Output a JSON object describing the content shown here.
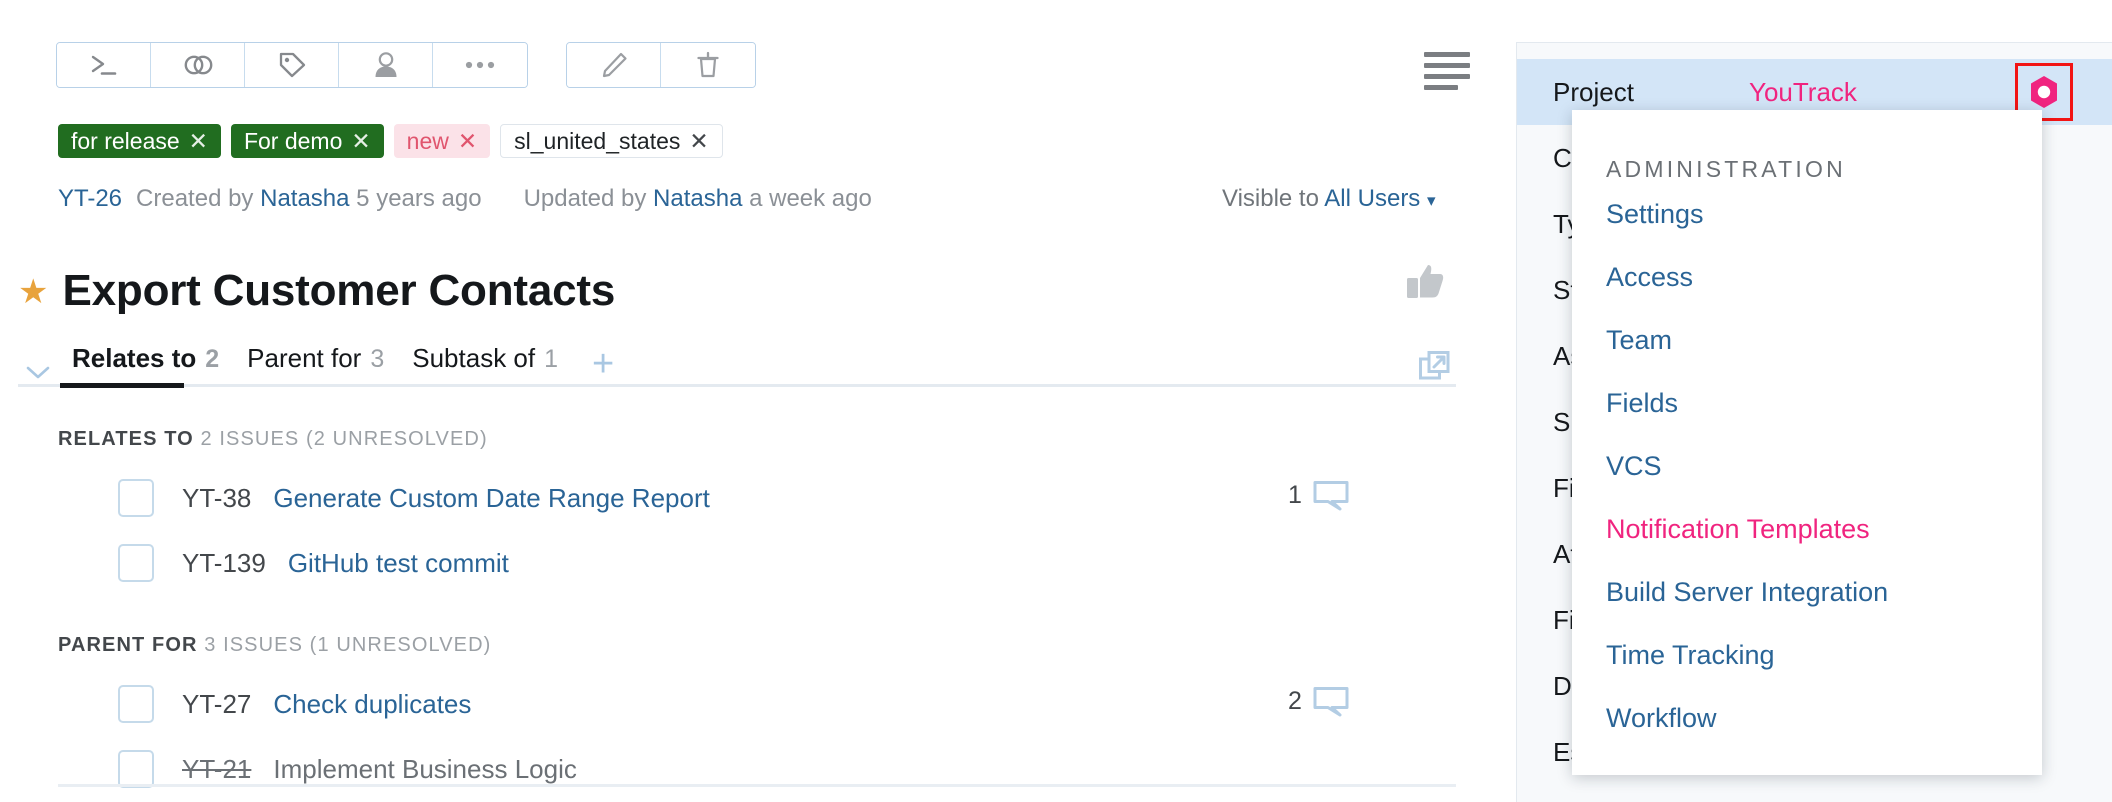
{
  "toolbar": {
    "left_group": [
      {
        "name": "command-dialog-icon",
        "label": "Apply command"
      },
      {
        "name": "link-icon",
        "label": "Link issue"
      },
      {
        "name": "tag-icon",
        "label": "Add tag"
      },
      {
        "name": "user-icon",
        "label": "Assign"
      },
      {
        "name": "more-icon",
        "label": "More"
      }
    ],
    "right_group": [
      {
        "name": "edit-pencil-icon",
        "label": "Edit"
      },
      {
        "name": "delete-trash-icon",
        "label": "Delete"
      }
    ],
    "list_view_icon": "list-view-icon"
  },
  "tags": [
    {
      "label": "for release",
      "style": "green",
      "close": "✕"
    },
    {
      "label": "For demo",
      "style": "green",
      "close": "✕"
    },
    {
      "label": "new",
      "style": "pink",
      "close": "✕"
    },
    {
      "label": "sl_united_states",
      "style": "plain",
      "close": "✕"
    }
  ],
  "meta": {
    "issue_id": "YT-26",
    "created_prefix": "Created by",
    "created_by": "Natasha",
    "created_when": "5 years ago",
    "updated_prefix": "Updated by",
    "updated_by": "Natasha",
    "updated_when": "a week ago",
    "visible_prefix": "Visible to",
    "visible_value": "All Users",
    "visible_caret": "▾"
  },
  "title": {
    "star": "★",
    "text": "Export Customer Contacts",
    "vote_icon": "thumbs-up-icon"
  },
  "tabs": {
    "items": [
      {
        "label": "Relates to",
        "count": "2",
        "active": true
      },
      {
        "label": "Parent for",
        "count": "3",
        "active": false
      },
      {
        "label": "Subtask of",
        "count": "1",
        "active": false
      }
    ],
    "add_label": "+",
    "external_link_icon": "external-link-icon",
    "collapse_icon": "chevron-down-icon"
  },
  "sections": [
    {
      "title_strong": "RELATES TO",
      "title_rest": "2 ISSUES (2 UNRESOLVED)",
      "rows": [
        {
          "id": "YT-38",
          "summary": "Generate Custom Date Range Report",
          "resolved": false,
          "comments": "1"
        },
        {
          "id": "YT-139",
          "summary": "GitHub test commit",
          "resolved": false,
          "comments": ""
        }
      ]
    },
    {
      "title_strong": "PARENT FOR",
      "title_rest": "3 ISSUES (1 UNRESOLVED)",
      "rows": [
        {
          "id": "YT-27",
          "summary": "Check duplicates",
          "resolved": false,
          "comments": "2"
        },
        {
          "id": "YT-21",
          "summary": "Implement Business Logic",
          "resolved": true,
          "comments": ""
        }
      ]
    }
  ],
  "sidebar": {
    "rows": [
      {
        "label": "Project",
        "value": "YouTrack",
        "highlight": true,
        "gear": true
      },
      {
        "label": "Com",
        "value": "",
        "highlight": false,
        "gear": false
      },
      {
        "label": "Typ",
        "value": "",
        "highlight": false,
        "gear": false
      },
      {
        "label": "Sta",
        "value": "",
        "highlight": false,
        "gear": false
      },
      {
        "label": "Ass",
        "value": "",
        "highlight": false,
        "gear": false
      },
      {
        "label": "Sub",
        "value": "",
        "highlight": false,
        "gear": false
      },
      {
        "label": "Fix",
        "value": "",
        "highlight": false,
        "gear": false
      },
      {
        "label": "Affe",
        "value": "",
        "highlight": false,
        "gear": false
      },
      {
        "label": "Fixe",
        "value": "",
        "highlight": false,
        "gear": false
      },
      {
        "label": "Due",
        "value": "",
        "highlight": false,
        "gear": false
      },
      {
        "label": "Est",
        "value": "",
        "highlight": false,
        "gear": false
      }
    ]
  },
  "dropdown": {
    "heading": "ADMINISTRATION",
    "items": [
      {
        "label": "Settings",
        "hovered": false
      },
      {
        "label": "Access",
        "hovered": false
      },
      {
        "label": "Team",
        "hovered": false
      },
      {
        "label": "Fields",
        "hovered": false
      },
      {
        "label": "VCS",
        "hovered": false
      },
      {
        "label": "Notification Templates",
        "hovered": true
      },
      {
        "label": "Build Server Integration",
        "hovered": false
      },
      {
        "label": "Time Tracking",
        "hovered": false
      },
      {
        "label": "Workflow",
        "hovered": false
      }
    ]
  },
  "colors": {
    "link_blue": "#2a6496",
    "accent_pink": "#f0247f",
    "tag_green": "#216d20",
    "tag_pink_bg": "#fbe2e8",
    "tag_pink_text": "#e0556e",
    "star_orange": "#e8a33d",
    "highlight_blue": "#d3e5f7",
    "red_outline": "#f21414"
  }
}
